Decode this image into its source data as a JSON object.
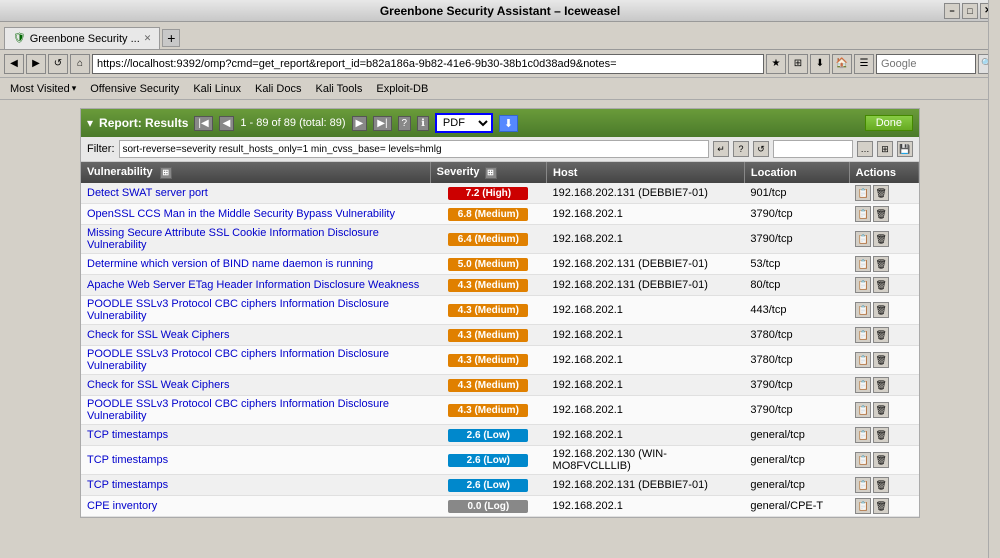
{
  "window": {
    "title": "Greenbone Security Assistant – Iceweasel",
    "min_btn": "−",
    "max_btn": "□",
    "close_btn": "✕"
  },
  "tab": {
    "label": "Greenbone Security ...",
    "favicon": "🛡"
  },
  "address": {
    "url": "https://localhost:9392/omp?cmd=get_report&report_id=b82a186a-9b82-41e6-9b30-38b1c0d38ad9&notes=",
    "search_placeholder": "Google"
  },
  "bookmarks": [
    {
      "label": "Most Visited",
      "arrow": "▾"
    },
    {
      "label": "Offensive Security"
    },
    {
      "label": "Kali Linux"
    },
    {
      "label": "Kali Docs"
    },
    {
      "label": "Kali Tools"
    },
    {
      "label": "Exploit-DB"
    }
  ],
  "report": {
    "arrow": "▾",
    "title": "Report: Results",
    "count_text": "1 - 89 of 89 (total: 89)",
    "format": "PDF",
    "done_label": "Done",
    "filter_label": "Filter:",
    "filter_value": "sort-reverse=severity result_hosts_only=1 min_cvss_base= levels=hmlg"
  },
  "table": {
    "headers": [
      "Vulnerability",
      "Severity",
      "Host",
      "Location",
      "Actions"
    ],
    "rows": [
      {
        "vuln": "Detect SWAT server port",
        "severity": "7.2 (High)",
        "sev_class": "sev-high",
        "host": "192.168.202.131 (DEBBIE7-01)",
        "location": "901/tcp"
      },
      {
        "vuln": "OpenSSL CCS Man in the Middle Security Bypass Vulnerability",
        "severity": "6.8 (Medium)",
        "sev_class": "sev-medium",
        "host": "192.168.202.1",
        "location": "3790/tcp"
      },
      {
        "vuln": "Missing Secure Attribute SSL Cookie Information Disclosure Vulnerability",
        "severity": "6.4 (Medium)",
        "sev_class": "sev-medium",
        "host": "192.168.202.1",
        "location": "3790/tcp"
      },
      {
        "vuln": "Determine which version of BIND name daemon is running",
        "severity": "5.0 (Medium)",
        "sev_class": "sev-medium",
        "host": "192.168.202.131 (DEBBIE7-01)",
        "location": "53/tcp"
      },
      {
        "vuln": "Apache Web Server ETag Header Information Disclosure Weakness",
        "severity": "4.3 (Medium)",
        "sev_class": "sev-medium",
        "host": "192.168.202.131 (DEBBIE7-01)",
        "location": "80/tcp"
      },
      {
        "vuln": "POODLE SSLv3 Protocol CBC ciphers Information Disclosure Vulnerability",
        "severity": "4.3 (Medium)",
        "sev_class": "sev-medium",
        "host": "192.168.202.1",
        "location": "443/tcp"
      },
      {
        "vuln": "Check for SSL Weak Ciphers",
        "severity": "4.3 (Medium)",
        "sev_class": "sev-medium",
        "host": "192.168.202.1",
        "location": "3780/tcp"
      },
      {
        "vuln": "POODLE SSLv3 Protocol CBC ciphers Information Disclosure Vulnerability",
        "severity": "4.3 (Medium)",
        "sev_class": "sev-medium",
        "host": "192.168.202.1",
        "location": "3780/tcp"
      },
      {
        "vuln": "Check for SSL Weak Ciphers",
        "severity": "4.3 (Medium)",
        "sev_class": "sev-medium",
        "host": "192.168.202.1",
        "location": "3790/tcp"
      },
      {
        "vuln": "POODLE SSLv3 Protocol CBC ciphers Information Disclosure Vulnerability",
        "severity": "4.3 (Medium)",
        "sev_class": "sev-medium",
        "host": "192.168.202.1",
        "location": "3790/tcp"
      },
      {
        "vuln": "TCP timestamps",
        "severity": "2.6 (Low)",
        "sev_class": "sev-low",
        "host": "192.168.202.1",
        "location": "general/tcp"
      },
      {
        "vuln": "TCP timestamps",
        "severity": "2.6 (Low)",
        "sev_class": "sev-low",
        "host": "192.168.202.130 (WIN-MO8FVCLLLIB)",
        "location": "general/tcp"
      },
      {
        "vuln": "TCP timestamps",
        "severity": "2.6 (Low)",
        "sev_class": "sev-low",
        "host": "192.168.202.131 (DEBBIE7-01)",
        "location": "general/tcp"
      },
      {
        "vuln": "CPE inventory",
        "severity": "0.0 (Log)",
        "sev_class": "sev-log",
        "host": "192.168.202.1",
        "location": "general/CPE-T"
      }
    ]
  }
}
